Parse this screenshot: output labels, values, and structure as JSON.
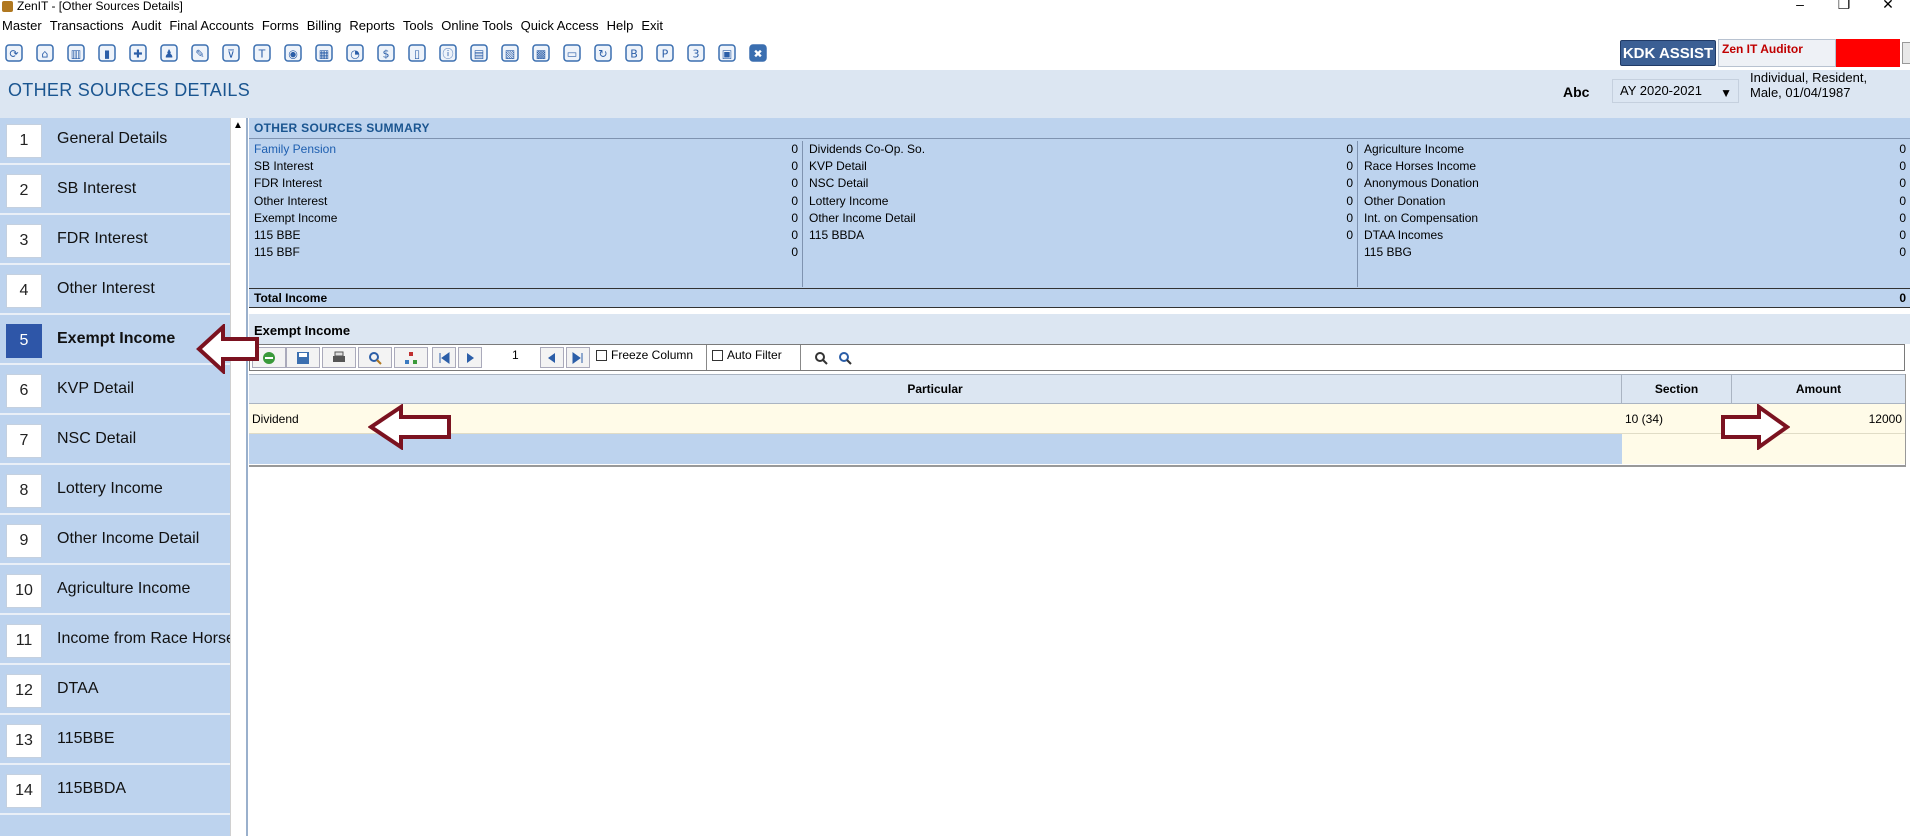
{
  "window": {
    "title": "ZenIT - [Other Sources Details]"
  },
  "menu": [
    "Master",
    "Transactions",
    "Audit",
    "Final Accounts",
    "Forms",
    "Billing",
    "Reports",
    "Tools",
    "Online Tools",
    "Quick Access",
    "Help",
    "Exit"
  ],
  "toolbar": {
    "icons": [
      "reload-icon",
      "home-icon",
      "building-icon",
      "bar-chart-icon",
      "gift-icon",
      "users-icon",
      "tools-icon",
      "filter-icon",
      "tax-icon",
      "eye-icon",
      "calculator-icon",
      "pie-chart-icon",
      "pay-icon",
      "book-icon",
      "info-icon",
      "document-icon",
      "document-edit-icon",
      "calendar-icon",
      "folder-add-icon",
      "refresh-icon",
      "bs-icon",
      "pdf-icon",
      "3cd-icon",
      "report-icon",
      "close-circle-icon"
    ],
    "kdk_label": "KDK ASSIST",
    "auditor": "Zen IT Auditor"
  },
  "header": {
    "title": "OTHER SOURCES DETAILS",
    "client": "Abc",
    "assessment_year": "AY 2020-2021",
    "client_info": "Individual, Resident, Male, 01/04/1987"
  },
  "sidebar": {
    "items": [
      {
        "num": "1",
        "label": "General Details"
      },
      {
        "num": "2",
        "label": "SB Interest"
      },
      {
        "num": "3",
        "label": "FDR Interest"
      },
      {
        "num": "4",
        "label": "Other Interest"
      },
      {
        "num": "5",
        "label": "Exempt Income"
      },
      {
        "num": "6",
        "label": "KVP Detail"
      },
      {
        "num": "7",
        "label": "NSC Detail"
      },
      {
        "num": "8",
        "label": "Lottery Income"
      },
      {
        "num": "9",
        "label": "Other Income Detail"
      },
      {
        "num": "10",
        "label": "Agriculture Income"
      },
      {
        "num": "11",
        "label": "Income from Race Horse"
      },
      {
        "num": "12",
        "label": "DTAA"
      },
      {
        "num": "13",
        "label": "115BBE"
      },
      {
        "num": "14",
        "label": "115BBDA"
      }
    ],
    "active_index": 4
  },
  "summary": {
    "title": "OTHER SOURCES SUMMARY",
    "columns": [
      [
        {
          "label": "Family Pension",
          "value": "0"
        },
        {
          "label": "SB Interest",
          "value": "0"
        },
        {
          "label": "FDR Interest",
          "value": "0"
        },
        {
          "label": "Other Interest",
          "value": "0"
        },
        {
          "label": "Exempt Income",
          "value": "0"
        },
        {
          "label": "115 BBE",
          "value": "0"
        },
        {
          "label": "115 BBF",
          "value": "0"
        }
      ],
      [
        {
          "label": "Dividends Co-Op. So.",
          "value": "0"
        },
        {
          "label": "KVP Detail",
          "value": "0"
        },
        {
          "label": "NSC Detail",
          "value": "0"
        },
        {
          "label": "Lottery Income",
          "value": "0"
        },
        {
          "label": "Other Income Detail",
          "value": "0"
        },
        {
          "label": "115 BBDA",
          "value": "0"
        }
      ],
      [
        {
          "label": "Agriculture Income",
          "value": "0"
        },
        {
          "label": "Race Horses Income",
          "value": "0"
        },
        {
          "label": "Anonymous Donation",
          "value": "0"
        },
        {
          "label": "Other Donation",
          "value": "0"
        },
        {
          "label": "Int. on Compensation",
          "value": "0"
        },
        {
          "label": "DTAA Incomes",
          "value": "0"
        },
        {
          "label": "115 BBG",
          "value": "0"
        }
      ]
    ],
    "total_label": "Total Income",
    "total_value": "0"
  },
  "section": {
    "title": "Exempt Income",
    "page": "1",
    "freeze_label": "Freeze Column",
    "filter_label": "Auto Filter"
  },
  "grid": {
    "headers": [
      "Particular",
      "Section",
      "Amount"
    ],
    "rows": [
      {
        "particular": "Dividend",
        "section": "10 (34)",
        "amount": "12000"
      }
    ]
  },
  "colors": {
    "panel": "#bdd3ee",
    "band": "#dce6f2",
    "title_blue": "#1a5590",
    "active_num": "#2e56a8",
    "arrow": "#7b1220",
    "row_highlight": "#fffbe8"
  }
}
